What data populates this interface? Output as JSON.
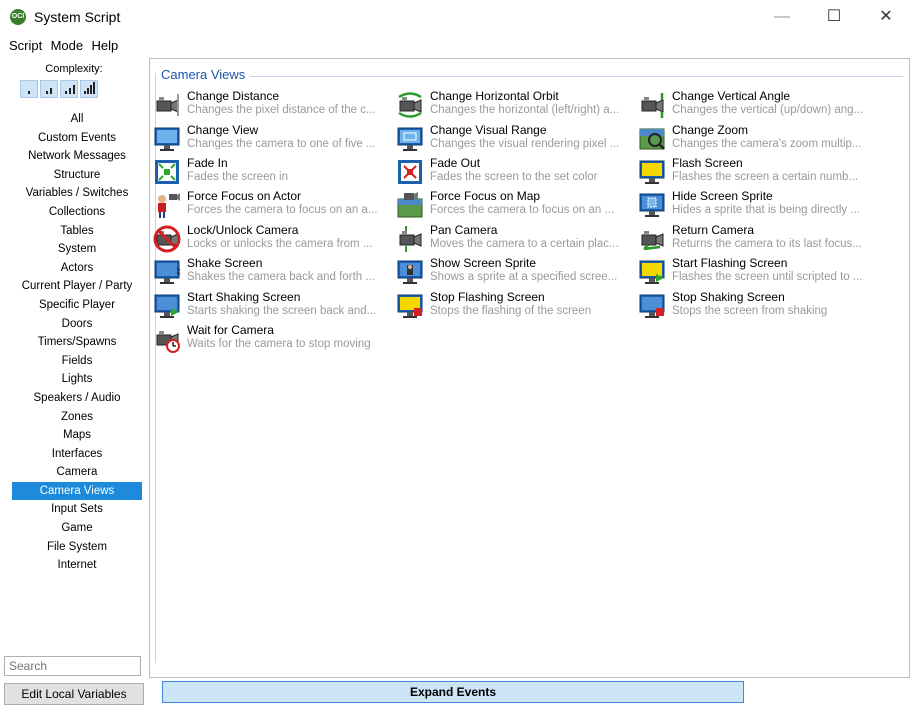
{
  "window": {
    "title": "System Script",
    "app_badge": "OCI",
    "minimize": "—",
    "maximize": "☐",
    "close": "✕"
  },
  "menu": [
    "Script",
    "Mode",
    "Help"
  ],
  "sidebar": {
    "complexity_label": "Complexity:",
    "complexity_levels": 4,
    "categories": [
      "All",
      "Custom Events",
      "Network Messages",
      "Structure",
      "Variables / Switches",
      "Collections",
      "Tables",
      "System",
      "Actors",
      "Current Player / Party",
      "Specific Player",
      "Doors",
      "Timers/Spawns",
      "Fields",
      "Lights",
      "Speakers / Audio",
      "Zones",
      "Maps",
      "Interfaces",
      "Camera",
      "Camera Views",
      "Input Sets",
      "Game",
      "File System",
      "Internet"
    ],
    "selected_category": "Camera Views",
    "search_placeholder": "Search"
  },
  "group": {
    "title": "Camera Views"
  },
  "events": [
    {
      "name": "Change Distance",
      "desc": "Changes the pixel distance of the c...",
      "icon": "camera-distance-icon"
    },
    {
      "name": "Change Horizontal Orbit",
      "desc": "Changes the horizontal (left/right) a...",
      "icon": "camera-orbit-icon"
    },
    {
      "name": "Change Vertical Angle",
      "desc": "Changes the vertical (up/down) ang...",
      "icon": "camera-angle-icon"
    },
    {
      "name": "Change View",
      "desc": "Changes the camera to one of five ...",
      "icon": "monitor-view-icon"
    },
    {
      "name": "Change Visual Range",
      "desc": "Changes the visual rendering pixel ...",
      "icon": "monitor-range-icon"
    },
    {
      "name": "Change Zoom",
      "desc": "Changes the camera's zoom multip...",
      "icon": "zoom-map-icon"
    },
    {
      "name": "Fade In",
      "desc": "Fades the screen in",
      "icon": "fade-in-icon"
    },
    {
      "name": "Fade Out",
      "desc": "Fades the screen to the set color",
      "icon": "fade-out-icon"
    },
    {
      "name": "Flash Screen",
      "desc": "Flashes the screen a certain numb...",
      "icon": "flash-screen-icon"
    },
    {
      "name": "Force Focus on Actor",
      "desc": "Forces the camera to focus on an a...",
      "icon": "focus-actor-icon"
    },
    {
      "name": "Force Focus on Map",
      "desc": "Forces the camera to focus on an ...",
      "icon": "focus-map-icon"
    },
    {
      "name": "Hide Screen Sprite",
      "desc": "Hides a sprite that is being directly ...",
      "icon": "hide-sprite-icon"
    },
    {
      "name": "Lock/Unlock Camera",
      "desc": "Locks or unlocks the camera from ...",
      "icon": "lock-camera-icon"
    },
    {
      "name": "Pan Camera",
      "desc": "Moves the camera to a certain plac...",
      "icon": "pan-camera-icon"
    },
    {
      "name": "Return Camera",
      "desc": "Returns the camera to its last focus...",
      "icon": "return-camera-icon"
    },
    {
      "name": "Shake Screen",
      "desc": "Shakes the camera back and forth ...",
      "icon": "shake-screen-icon"
    },
    {
      "name": "Show Screen Sprite",
      "desc": "Shows a sprite at a specified scree...",
      "icon": "show-sprite-icon"
    },
    {
      "name": "Start Flashing Screen",
      "desc": "Flashes the screen until scripted to ...",
      "icon": "start-flash-icon"
    },
    {
      "name": "Start Shaking Screen",
      "desc": "Starts shaking the screen back and...",
      "icon": "start-shake-icon"
    },
    {
      "name": "Stop Flashing Screen",
      "desc": "Stops the flashing of the screen",
      "icon": "stop-flash-icon"
    },
    {
      "name": "Stop Shaking Screen",
      "desc": "Stops the screen from shaking",
      "icon": "stop-shake-icon"
    },
    {
      "name": "Wait for Camera",
      "desc": "Waits for the camera to stop moving",
      "icon": "wait-camera-icon"
    }
  ],
  "buttons": {
    "edit_local": "Edit Local Variables",
    "expand": "Expand Events"
  },
  "colors": {
    "selection": "#1e8adb",
    "group_title": "#1a55a8",
    "expand_bg": "#cce4f7",
    "description": "#9a9a9a"
  }
}
